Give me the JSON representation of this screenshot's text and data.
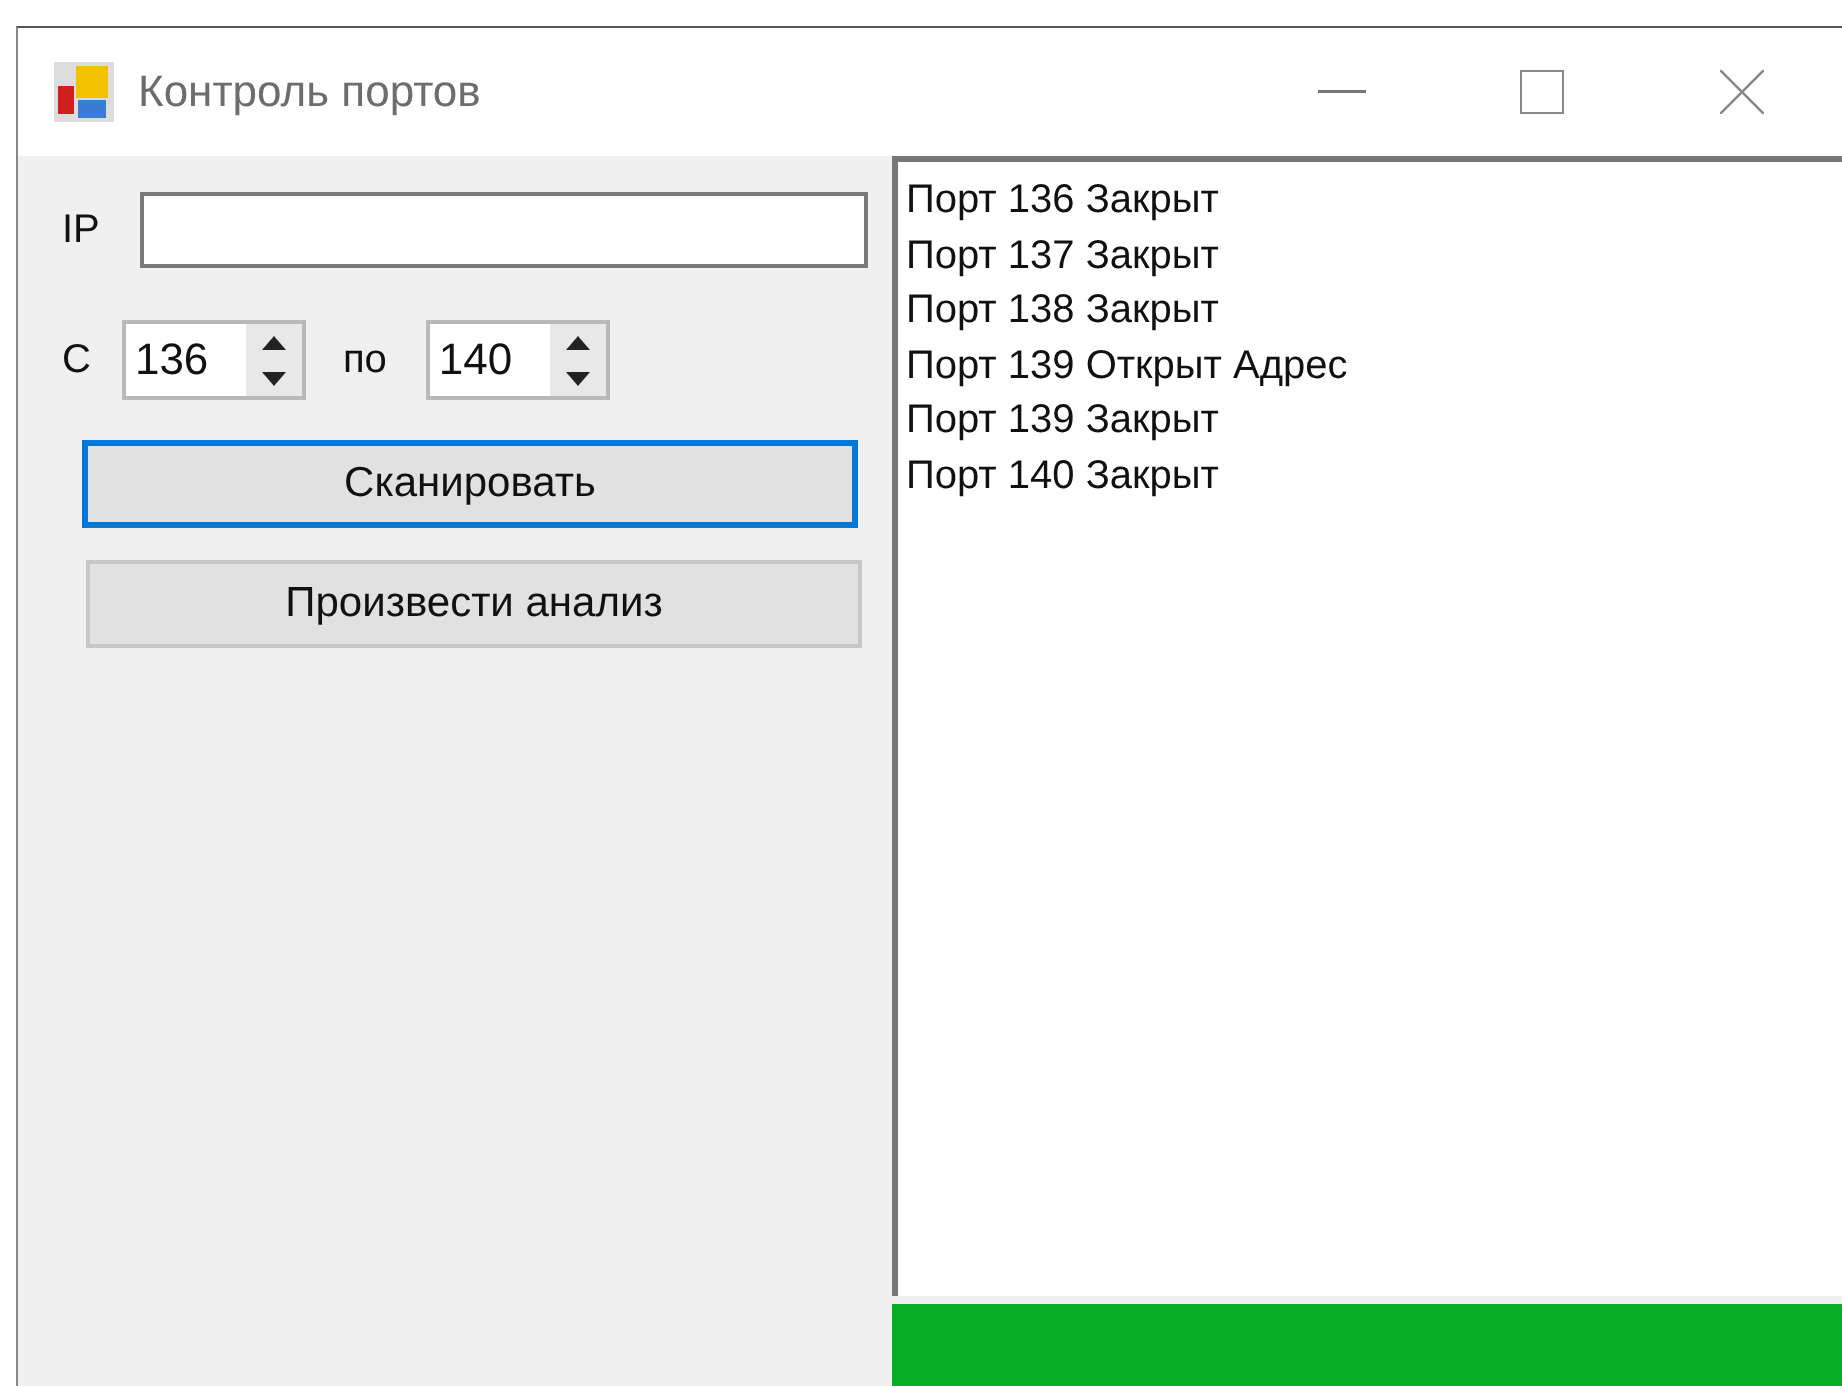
{
  "window": {
    "title": "Контроль портов"
  },
  "ip": {
    "label": "IP"
  },
  "range": {
    "from_label": "С",
    "from_value": "136",
    "to_label": "по",
    "to_value": "140"
  },
  "buttons": [
    {
      "label": "Сканировать",
      "focused": true
    },
    {
      "label": "Произвести анализ",
      "focused": false
    }
  ],
  "log": [
    "Порт 136 Закрыт",
    "Порт 137 Закрыт",
    "Порт 138 Закрыт",
    "Порт 139 Открыт Адрес",
    "Порт 139 Закрыт",
    "Порт 140 Закрыт"
  ],
  "progress": {
    "level": 1
  }
}
